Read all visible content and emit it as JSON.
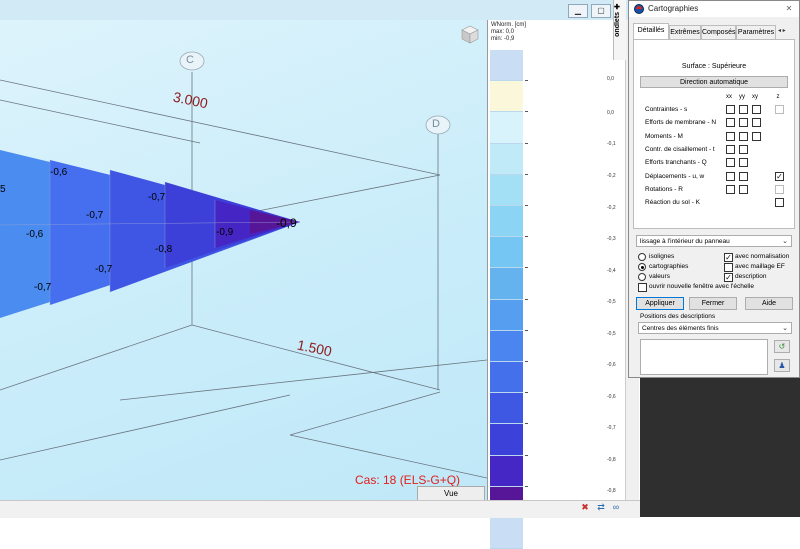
{
  "viewport": {
    "axis_labels": [
      "C",
      "D"
    ],
    "dimensions": [
      "3.000",
      "1.500"
    ],
    "contour_values": [
      "-0,6",
      "-0,7",
      "-0,6",
      "-0,7",
      "-0,7",
      "-0,8",
      "-0,7",
      "-0,9",
      "-0,9",
      "5"
    ],
    "case_label": "Cas: 18 (ELS-G+Q)",
    "view_tab": "Vue",
    "window_buttons": [
      "▁",
      "▢"
    ]
  },
  "legend": {
    "header": [
      "WNorm. [cm]",
      "max: 0,0",
      "min: -0,9"
    ],
    "levels": [
      "0,0",
      "0,0",
      "-0,1",
      "-0,2",
      "-0,2",
      "-0,3",
      "-0,4",
      "-0,5",
      "-0,5",
      "-0,6",
      "-0,6",
      "-0,7",
      "-0,8",
      "-0,8"
    ],
    "colors": [
      "#c9def4",
      "#fbf7da",
      "#d8f3fb",
      "#c0eaf8",
      "#a3e0f6",
      "#8bd4f3",
      "#75c6f2",
      "#64b3ef",
      "#559ef0",
      "#4b86f0",
      "#4470ec",
      "#3f58e4",
      "#3c42d9",
      "#4427c4",
      "#561697",
      "#c9def4"
    ]
  },
  "side_strip": {
    "label": "ondlets ✚"
  },
  "dialog": {
    "title": "Cartographies",
    "close": "✕",
    "tabs": [
      "Détaillés",
      "Extrêmes",
      "Composés",
      "Paramètres"
    ],
    "tab_arrows": "◂ ▸",
    "surface_label": "Surface : Supérieure",
    "direction_button": "Direction automatique",
    "columns": [
      "xx",
      "yy",
      "xy",
      "z"
    ],
    "rows": [
      {
        "label": "Contraintes - s",
        "checks": [
          false,
          false,
          false,
          false
        ],
        "dim_z": true
      },
      {
        "label": "Efforts de membrane - N",
        "checks": [
          false,
          false,
          false,
          null
        ],
        "dim_z": false
      },
      {
        "label": "Moments - M",
        "checks": [
          false,
          false,
          false,
          null
        ],
        "dim_z": false
      },
      {
        "label": "Contr. de cisaillement - t",
        "checks": [
          false,
          false,
          null,
          null
        ],
        "dim_z": false
      },
      {
        "label": "Efforts tranchants - Q",
        "checks": [
          false,
          false,
          null,
          null
        ],
        "dim_z": false
      },
      {
        "label": "Déplacements - u, w",
        "checks": [
          false,
          false,
          null,
          true
        ],
        "dim_z": false
      },
      {
        "label": "Rotations - R",
        "checks": [
          false,
          false,
          null,
          false
        ],
        "dim_z": true
      },
      {
        "label": "Réaction du sol - K",
        "checks": [
          null,
          null,
          null,
          false
        ],
        "dim_z": false
      }
    ],
    "smoothing_select": "lissage à l'intérieur du panneau",
    "options": {
      "isolignes": "isolignes",
      "cartographies": "cartographies",
      "valeurs": "valeurs",
      "normalisation": "avec normalisation",
      "maillage": "avec maillage EF",
      "description": "description",
      "nouvelle_fenetre": "ouvrir nouvelle fenêtre avec l'échelle"
    },
    "selected_mode": "cartographies",
    "buttons": {
      "apply": "Appliquer",
      "close": "Fermer",
      "help": "Aide"
    },
    "descriptions_label": "Positions des descriptions",
    "descriptions_select": "Centres des éléments finis",
    "select_arrow": "⌄"
  }
}
